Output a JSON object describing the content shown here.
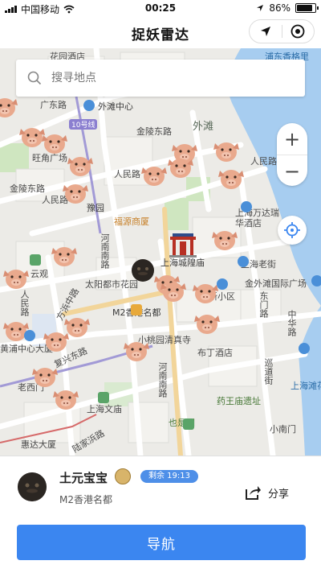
{
  "status": {
    "carrier": "中国移动",
    "time": "00:25",
    "battery": "86%",
    "battery_level": 0.86
  },
  "navbar": {
    "title": "捉妖雷达"
  },
  "search": {
    "placeholder": "搜寻地点"
  },
  "map": {
    "labels": {
      "l1": "花园酒店",
      "l2": "广东路",
      "l3": "外滩中心",
      "l4": "10号线",
      "l5": "金陵东路",
      "l6": "外滩",
      "l7": "旺角广场",
      "l8": "金陵东路",
      "l9": "人民路",
      "l10": "人民路",
      "l11": "豫园",
      "l12": "福源商厦",
      "l13": "上海万达瑞华酒店",
      "l14": "河南南路",
      "l15": "上海城隍庙",
      "l16": "上海老街",
      "l17": "云观",
      "l18": "太阳都市花园",
      "l19": "金外滩国际广场",
      "l20": "新小区",
      "l21": "M2香港名都",
      "l22": "方浜中路",
      "l23": "人民路",
      "l24": "黄浦中心大厦",
      "l25": "小桃园清真寺",
      "l26": "布丁酒店",
      "l27": "复兴东路",
      "l28": "河南南路",
      "l29": "老西门",
      "l30": "上海文庙",
      "l31": "药王庙遗址",
      "l32": "也是园",
      "l33": "上海滩花园",
      "l34": "惠达大厦",
      "l35": "小南门",
      "l36": "浦东香格里",
      "l37": "人民路",
      "l38": "东门路",
      "l39": "中华路",
      "l40": "巡道街",
      "l41": "陆家浜路"
    }
  },
  "panel": {
    "name": "土元宝宝",
    "badge": "剩余 19:13",
    "location": "M2香港名都",
    "share_label": "分享",
    "nav_label": "导航"
  }
}
